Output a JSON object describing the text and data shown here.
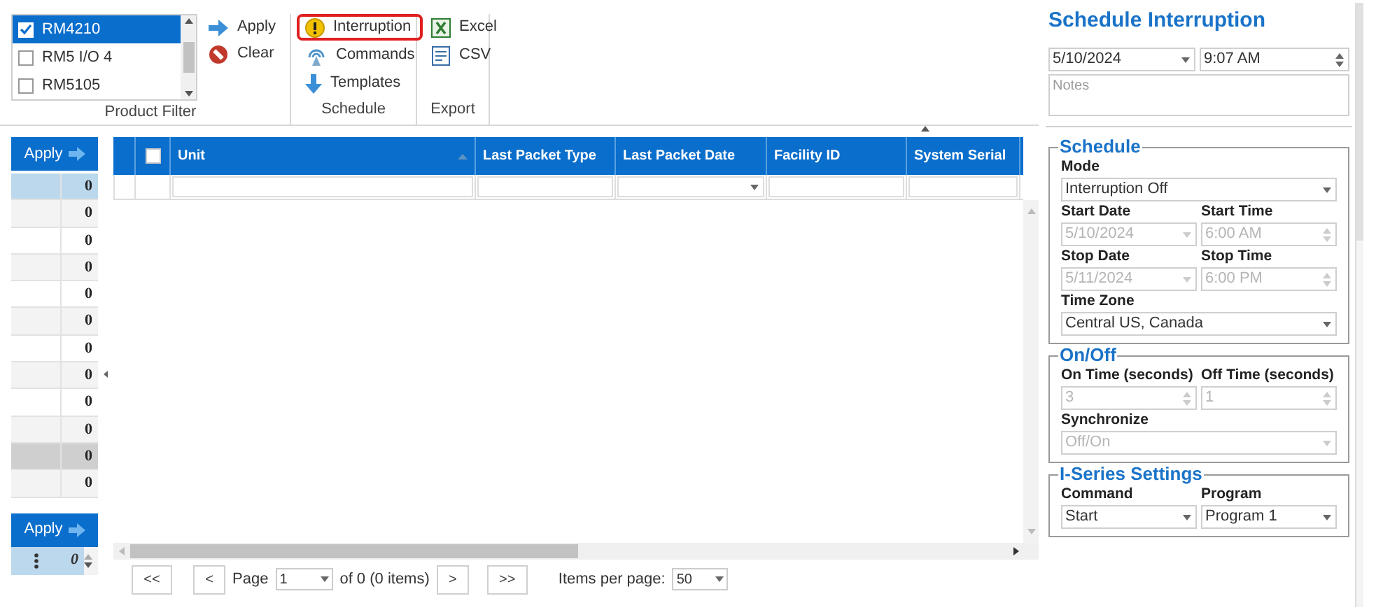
{
  "ribbon": {
    "product_filter": {
      "items": [
        {
          "label": "RM4210",
          "checked": true,
          "selected": true
        },
        {
          "label": "RM5 I/O 4",
          "checked": false,
          "selected": false
        },
        {
          "label": "RM5105",
          "checked": false,
          "selected": false
        }
      ],
      "buttons": [
        {
          "label": "Apply",
          "kind": "apply"
        },
        {
          "label": "Clear",
          "kind": "clear"
        }
      ],
      "group_label": "Product Filter"
    },
    "schedule": {
      "buttons": [
        {
          "label": "Interruption",
          "kind": "warning",
          "selected": true
        },
        {
          "label": "Commands",
          "kind": "broadcast",
          "selected": false
        },
        {
          "label": "Templates",
          "kind": "download",
          "selected": false
        }
      ],
      "group_label": "Schedule"
    },
    "export": {
      "buttons": [
        {
          "label": "Excel",
          "kind": "excel"
        },
        {
          "label": "CSV",
          "kind": "csv"
        }
      ],
      "group_label": "Export"
    }
  },
  "left_panel": {
    "apply_top": "Apply",
    "rows": [
      {
        "value": "0",
        "selected": true,
        "hovered": false
      },
      {
        "value": "0",
        "selected": false,
        "hovered": false
      },
      {
        "value": "0",
        "selected": false,
        "hovered": false
      },
      {
        "value": "0",
        "selected": false,
        "hovered": false
      },
      {
        "value": "0",
        "selected": false,
        "hovered": false
      },
      {
        "value": "0",
        "selected": false,
        "hovered": false
      },
      {
        "value": "0",
        "selected": false,
        "hovered": false
      },
      {
        "value": "0",
        "selected": false,
        "hovered": false
      },
      {
        "value": "0",
        "selected": false,
        "hovered": false
      },
      {
        "value": "0",
        "selected": false,
        "hovered": false
      },
      {
        "value": "0",
        "selected": false,
        "hovered": true
      },
      {
        "value": "0",
        "selected": false,
        "hovered": false
      }
    ],
    "apply_bottom": "Apply",
    "bottom_value": "0"
  },
  "grid": {
    "header_checked": false,
    "columns": [
      {
        "label": "Unit",
        "kind": "text",
        "sorted": true
      },
      {
        "label": "Last Packet Type",
        "kind": "text",
        "sorted": false
      },
      {
        "label": "Last Packet Date",
        "kind": "dropdown",
        "sorted": false
      },
      {
        "label": "Facility ID",
        "kind": "text",
        "sorted": false
      },
      {
        "label": "System Serial",
        "kind": "text",
        "sorted": false
      }
    ],
    "pager": {
      "first": "<<",
      "previous": "<",
      "page_label": "Page",
      "page": "1",
      "summary": "of 0 (0 items)",
      "next": ">",
      "last": ">>",
      "per_page_label": "Items per page:",
      "per_page": "50"
    }
  },
  "schedule_panel": {
    "title": "Schedule Interruption",
    "date": "5/10/2024",
    "time": "9:07 AM",
    "notes_placeholder": "Notes",
    "sections": [
      {
        "title": "Schedule",
        "fields": [
          {
            "label": "Mode",
            "kind": "dropdown",
            "value": "Interruption Off",
            "disabled": false,
            "full_width": true
          },
          {
            "label": "Start Date",
            "kind": "dropdown",
            "value": "5/10/2024",
            "disabled": true,
            "full_width": false
          },
          {
            "label": "Start Time",
            "kind": "spinner",
            "value": "6:00 AM",
            "disabled": true,
            "full_width": false
          },
          {
            "label": "Stop Date",
            "kind": "dropdown",
            "value": "5/11/2024",
            "disabled": true,
            "full_width": false
          },
          {
            "label": "Stop Time",
            "kind": "spinner",
            "value": "6:00 PM",
            "disabled": true,
            "full_width": false
          },
          {
            "label": "Time Zone",
            "kind": "dropdown",
            "value": "Central US, Canada",
            "disabled": false,
            "full_width": true
          }
        ]
      },
      {
        "title": "On/Off",
        "fields": [
          {
            "label": "On Time (seconds)",
            "kind": "spinner",
            "value": "3",
            "disabled": true,
            "full_width": false
          },
          {
            "label": "Off Time (seconds)",
            "kind": "spinner",
            "value": "1",
            "disabled": true,
            "full_width": false
          },
          {
            "label": "Synchronize",
            "kind": "dropdown",
            "value": "Off/On",
            "disabled": true,
            "full_width": true
          }
        ]
      },
      {
        "title": "I-Series Settings",
        "fields": [
          {
            "label": "Command",
            "kind": "dropdown",
            "value": "Start",
            "disabled": false,
            "full_width": false
          },
          {
            "label": "Program",
            "kind": "dropdown",
            "value": "Program 1",
            "disabled": false,
            "full_width": false
          }
        ]
      }
    ]
  }
}
